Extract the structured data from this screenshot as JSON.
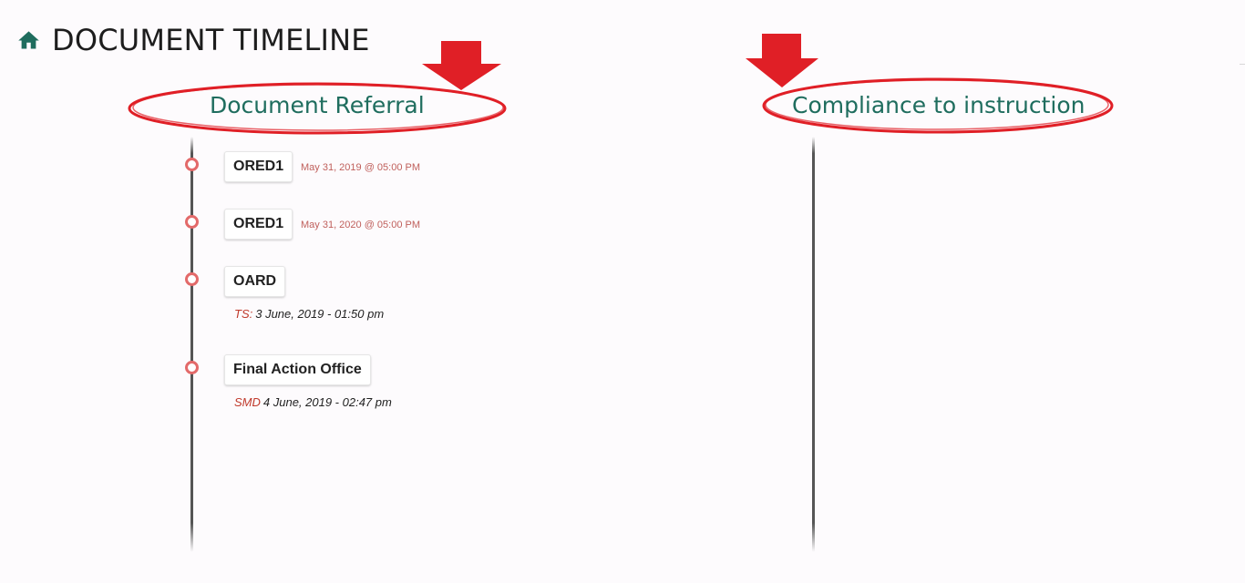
{
  "header": {
    "title": "DOCUMENT TIMELINE",
    "icon": "home-icon"
  },
  "colors": {
    "accent": "#1f6d5e",
    "dot": "#e36a6a",
    "annotation": "#e01f26",
    "date": "#c0605c"
  },
  "sections": {
    "referral": {
      "heading": "Document Referral",
      "entries": [
        {
          "office": "ORED1",
          "date": "May 31, 2019 @ 05:00 PM"
        },
        {
          "office": "ORED1",
          "date": "May 31, 2020 @ 05:00 PM"
        },
        {
          "office": "OARD",
          "meta_code": "TS:",
          "meta_time": "3 June, 2019 - 01:50 pm"
        },
        {
          "office": "Final Action Office",
          "meta_code": "SMD",
          "meta_time": "4 June, 2019 - 02:47 pm"
        }
      ]
    },
    "compliance": {
      "heading": "Compliance to instruction",
      "entries": []
    }
  }
}
